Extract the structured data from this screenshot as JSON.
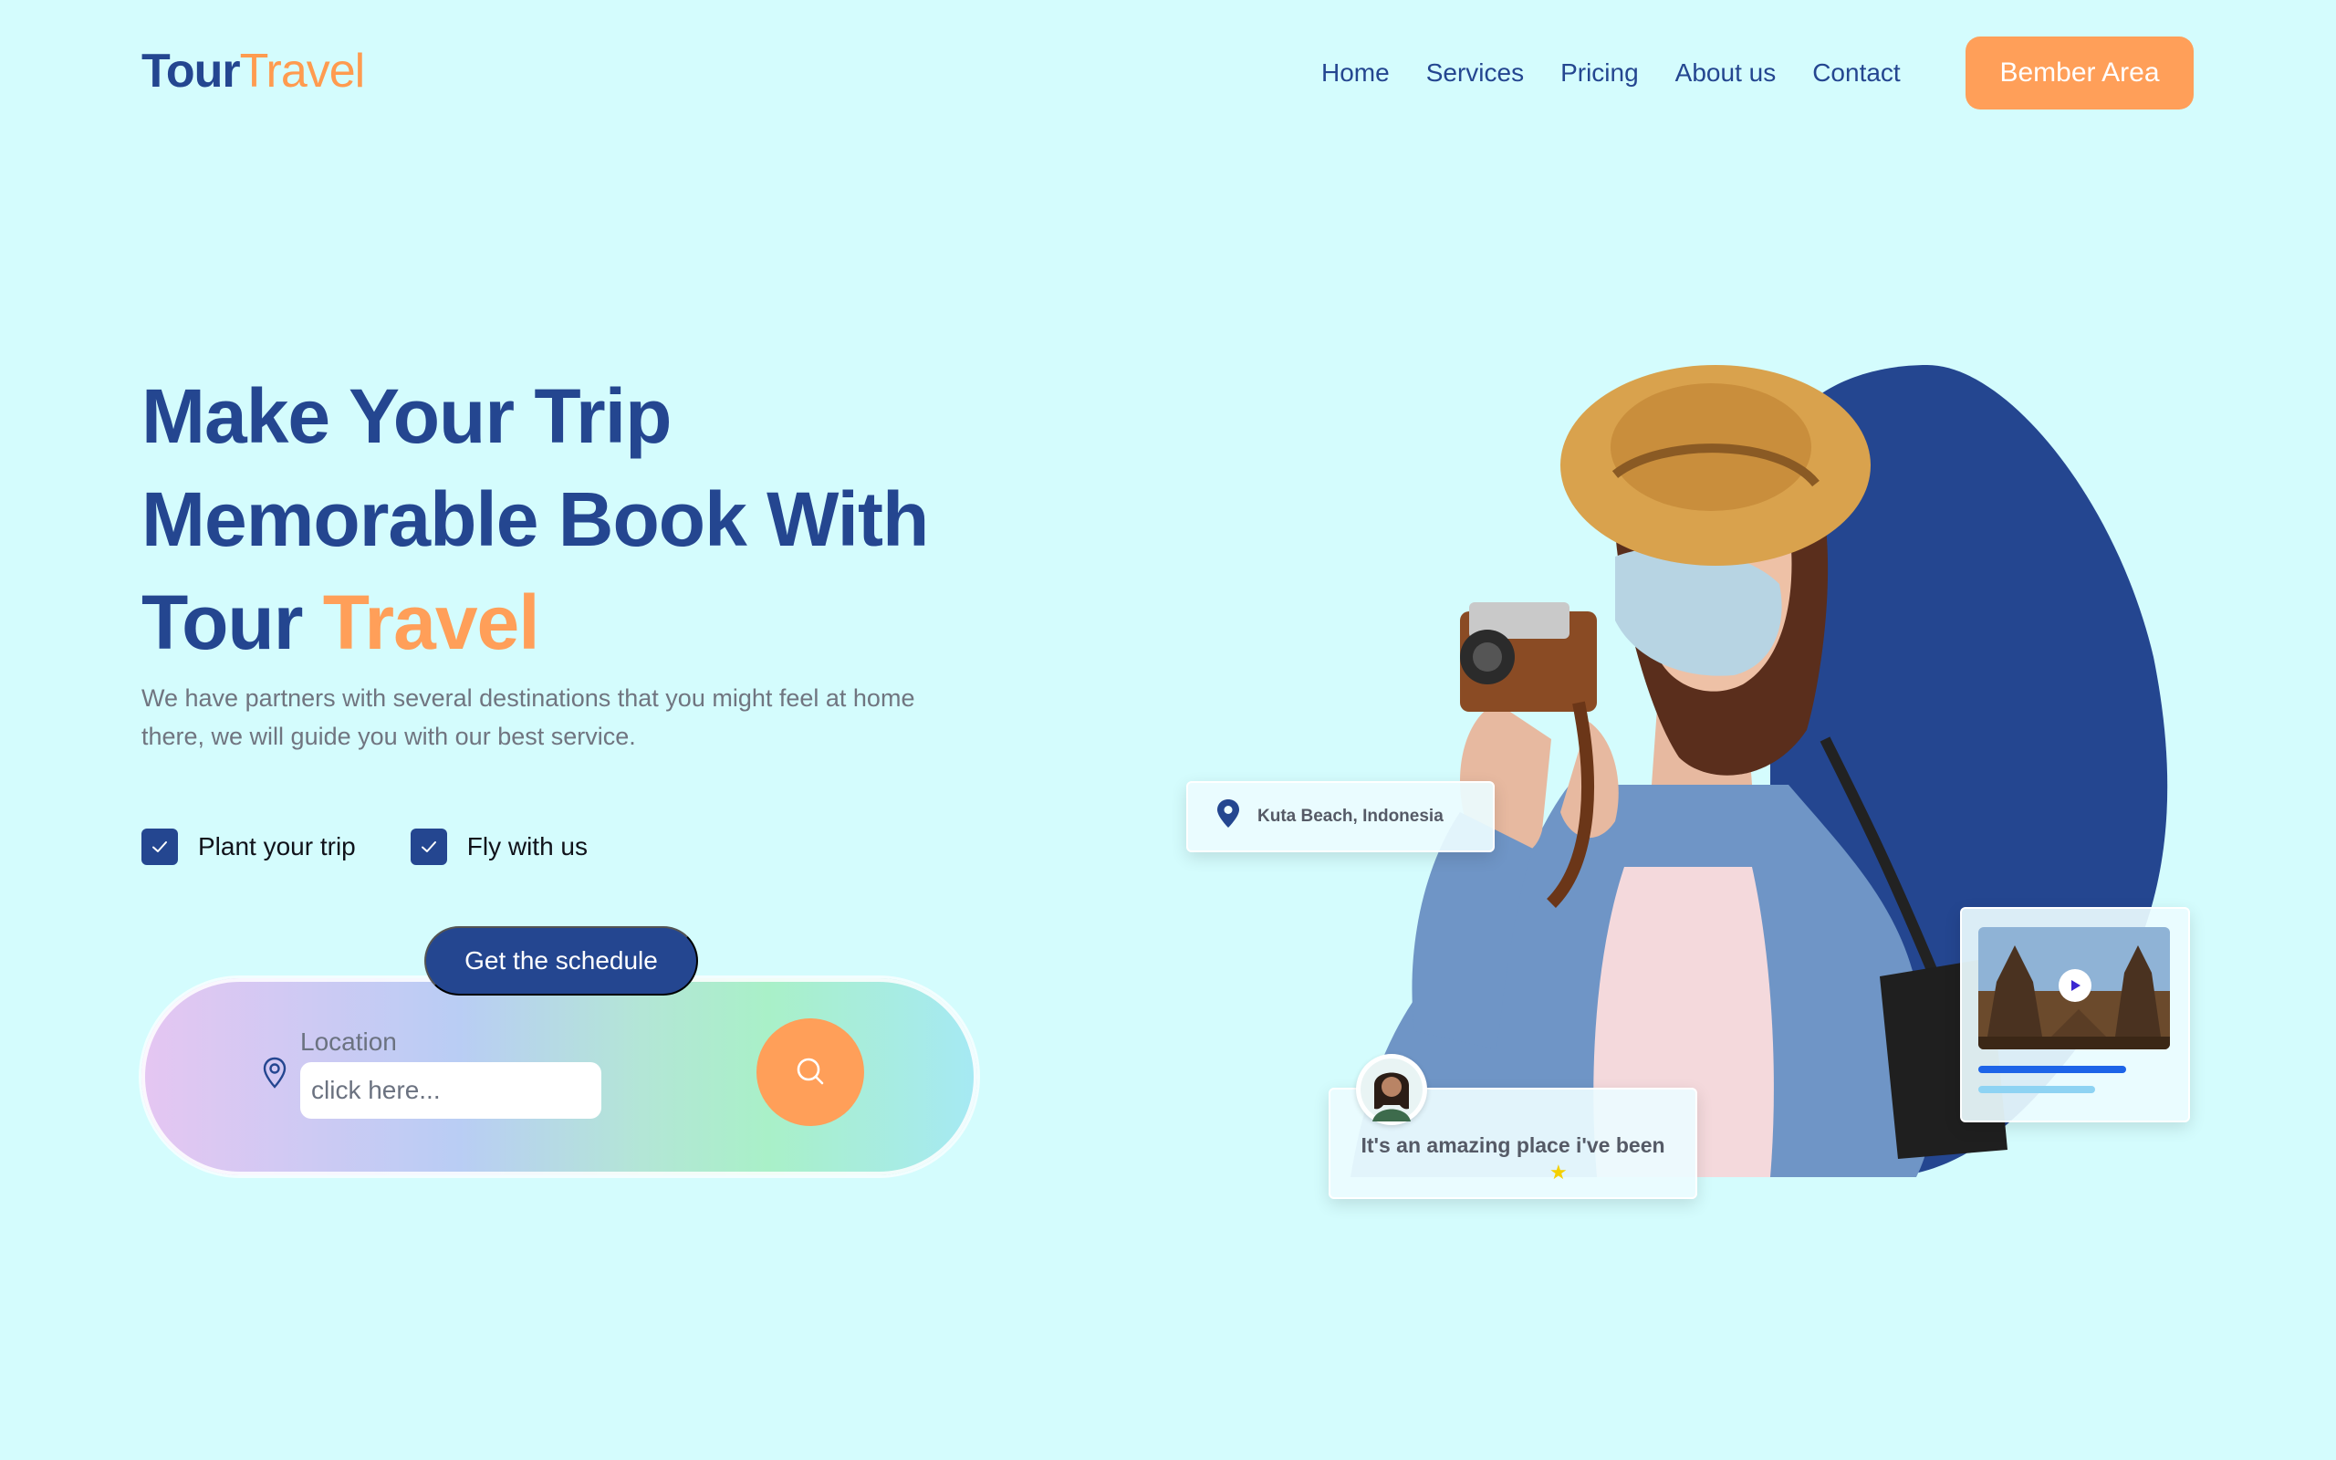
{
  "brand": {
    "part1": "Tour",
    "part2": "Travel"
  },
  "nav": {
    "items": [
      {
        "label": "Home"
      },
      {
        "label": "Services"
      },
      {
        "label": "Pricing"
      },
      {
        "label": "About us"
      },
      {
        "label": "Contact"
      }
    ],
    "cta_label": "Bember Area"
  },
  "hero": {
    "title_line1": "Make Your Trip",
    "title_line2": "Memorable Book With",
    "title_line3_plain": "Tour",
    "title_line3_accent": "Travel",
    "subtitle": "We have partners with several destinations that you might feel at home there, we will guide you with our best service.",
    "features": [
      {
        "label": "Plant your trip"
      },
      {
        "label": "Fly with us"
      }
    ],
    "schedule_label": "Get the schedule",
    "search": {
      "location_label": "Location",
      "placeholder": "click here..."
    }
  },
  "cards": {
    "location_tag": "Kuta Beach, Indonesia",
    "review_text": "It's an amazing place i've been",
    "review_rating": 1,
    "video_progress": 0.6
  },
  "icons": {
    "check": "check-icon",
    "pin": "location-pin-icon",
    "search": "search-icon",
    "play": "play-icon",
    "star": "star-icon"
  },
  "colors": {
    "background": "#d4fcfd",
    "primary": "#244690",
    "accent": "#ff9f59",
    "text_muted": "#707580"
  }
}
